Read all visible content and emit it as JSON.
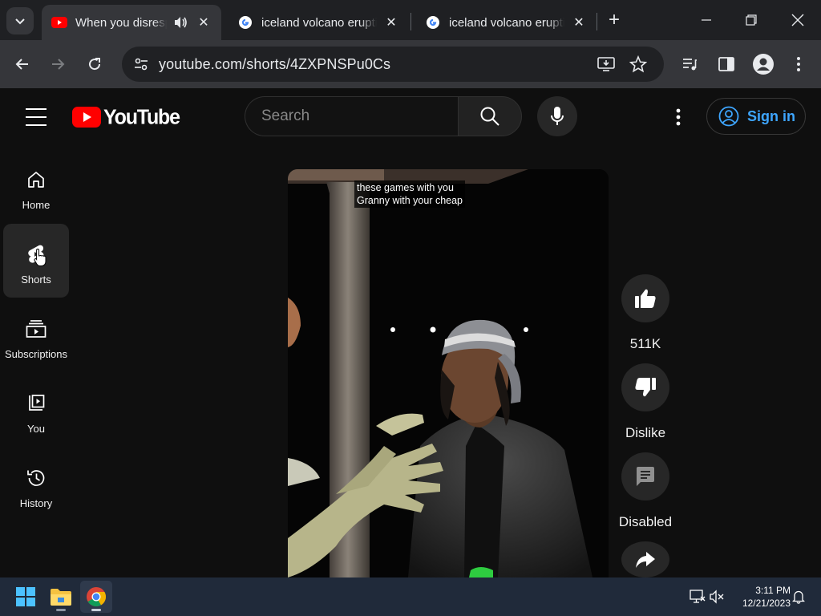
{
  "browser": {
    "tabs": [
      {
        "title": "When you disrespect Granny",
        "favicon": "youtube-favicon",
        "active": true
      },
      {
        "title": "iceland volcano eruption - Google Search",
        "favicon": "google-favicon",
        "active": false
      },
      {
        "title": "iceland volcano eruption - Google Search",
        "favicon": "google-favicon",
        "active": false
      }
    ],
    "url": "youtube.com/shorts/4ZXPNSPu0Cs"
  },
  "youtube": {
    "logo_text": "YouTube",
    "search_placeholder": "Search",
    "sign_in_label": "Sign in",
    "sidebar": [
      {
        "label": "Home",
        "icon": "home-icon"
      },
      {
        "label": "Shorts",
        "icon": "shorts-icon",
        "active": true
      },
      {
        "label": "Subscriptions",
        "icon": "subscriptions-icon"
      },
      {
        "label": "You",
        "icon": "you-icon"
      },
      {
        "label": "History",
        "icon": "history-icon"
      }
    ],
    "short": {
      "caption_lines": [
        "these games with you",
        "Granny with your cheap"
      ]
    },
    "actions": {
      "like_count": "511K",
      "dislike_label": "Dislike",
      "comments_label": "Disabled"
    }
  },
  "taskbar": {
    "time": "3:11 PM",
    "date": "12/21/2023"
  },
  "colors": {
    "youtube_red": "#ff0000",
    "signin_blue": "#3ea6ff",
    "page_bg": "#0f0f0f"
  }
}
